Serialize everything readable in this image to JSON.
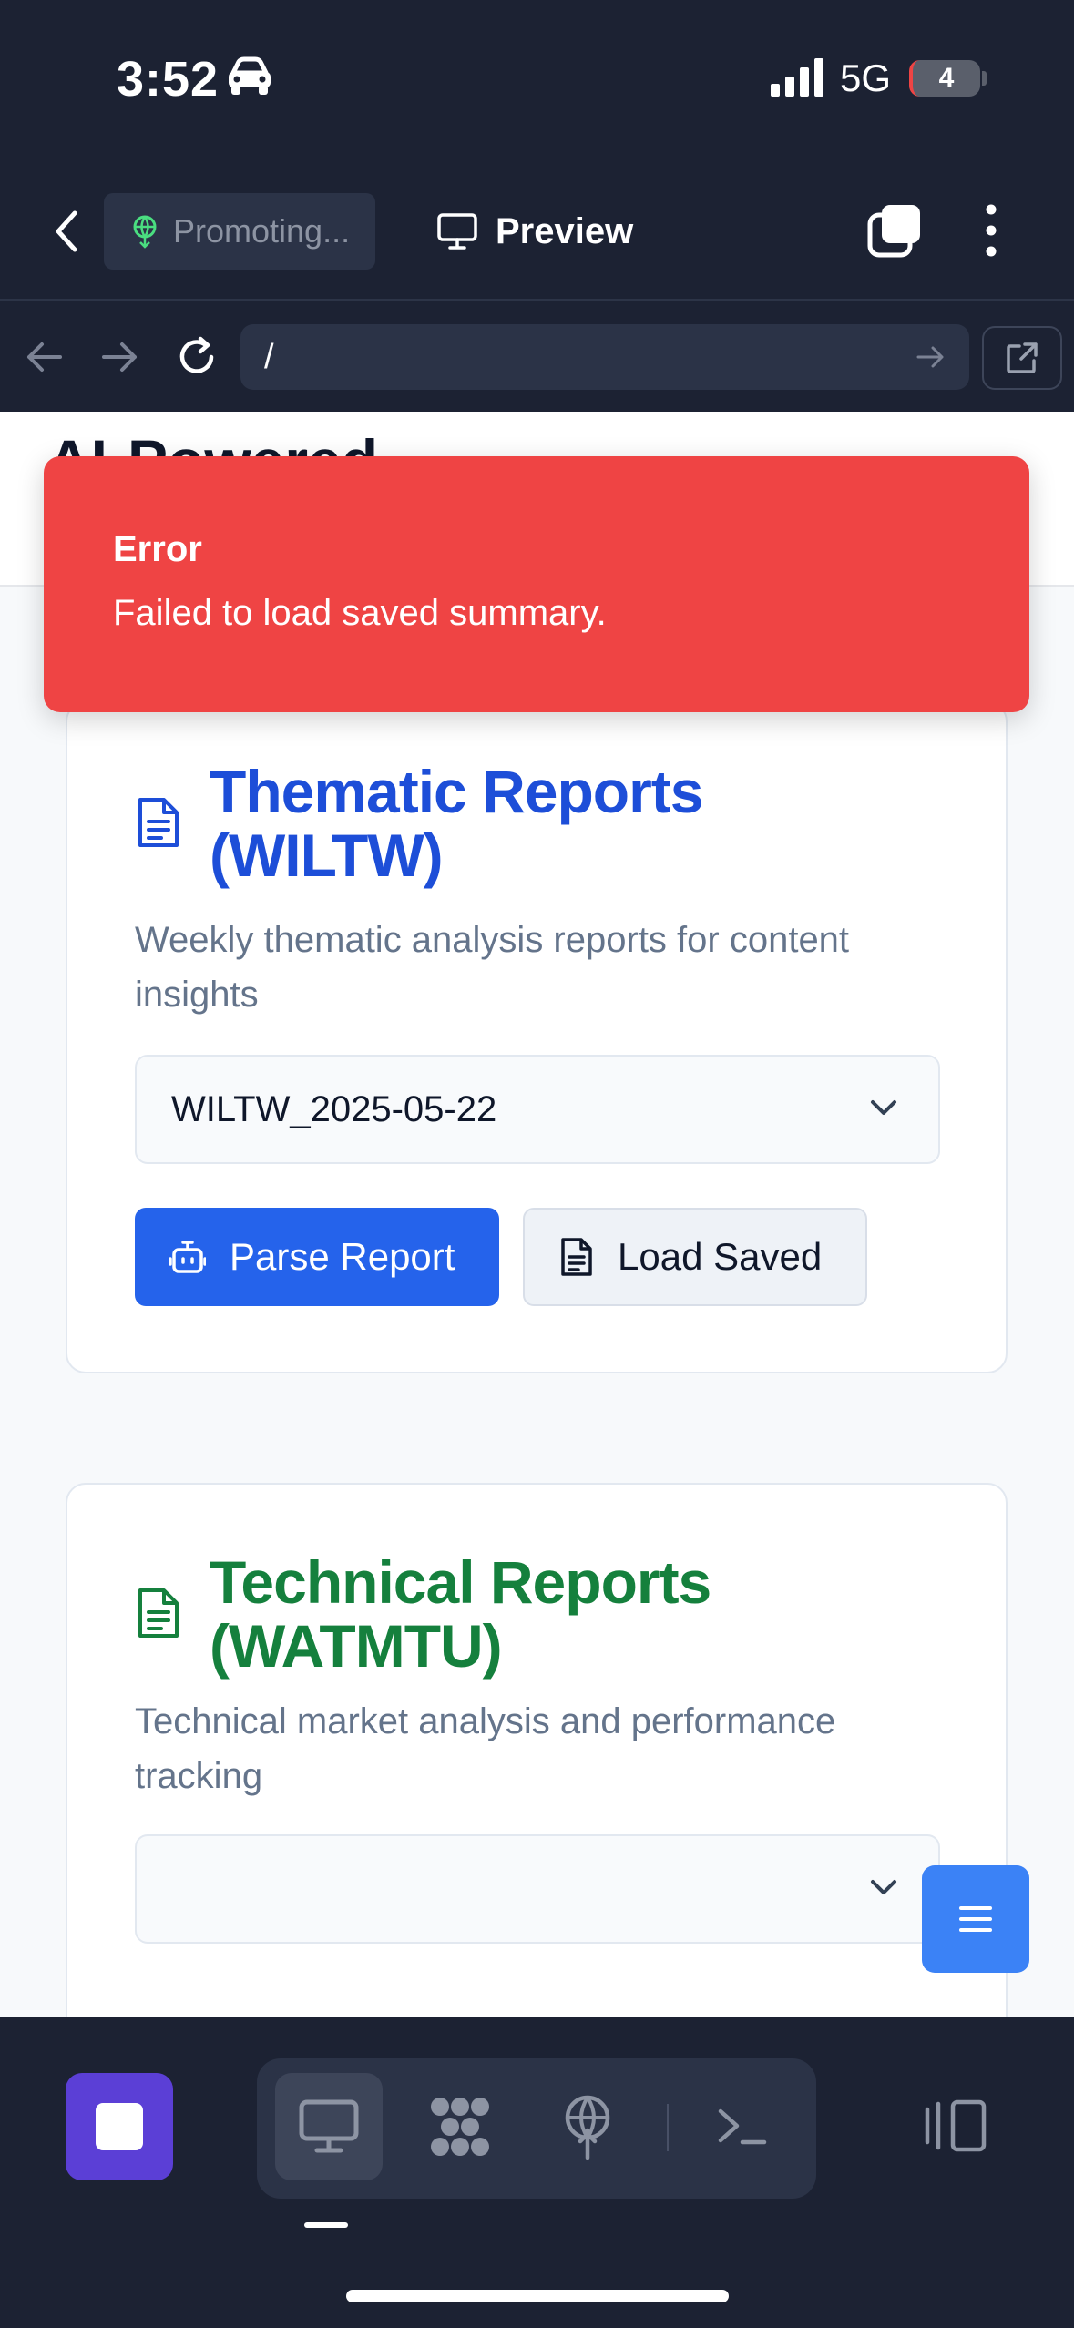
{
  "status_bar": {
    "time": "3:52",
    "network": "5G",
    "battery": "4"
  },
  "toolbar": {
    "project_label": "Promoting...",
    "preview_label": "Preview"
  },
  "url_bar": {
    "path": "/"
  },
  "page": {
    "heading": "AI-Powered"
  },
  "toast": {
    "title": "Error",
    "message": "Failed to load saved summary."
  },
  "cards": [
    {
      "title_line1": "Thematic Reports",
      "title_line2": "(WILTW)",
      "description": "Weekly thematic analysis reports for content insights",
      "selected_report": "WILTW_2025-05-22",
      "parse_label": "Parse Report",
      "load_label": "Load Saved",
      "accent": "#1d4ed8"
    },
    {
      "title_line1": "Technical Reports",
      "title_line2": "(WATMTU)",
      "description": "Technical market analysis and performance tracking",
      "selected_report": "",
      "accent": "#15803d"
    }
  ],
  "colors": {
    "chrome_bg": "#1c2233",
    "primary_button": "#2563eb",
    "error_toast": "#ef4444",
    "stop_button": "#5b3fd6"
  },
  "icons": [
    "car-icon",
    "signal-icon",
    "globe-icon",
    "monitor-icon",
    "tabs-icon",
    "more-icon",
    "back-arrow-icon",
    "forward-arrow-icon",
    "reload-icon",
    "external-link-icon",
    "document-icon",
    "robot-icon",
    "chevron-down-icon",
    "menu-icon",
    "stop-icon",
    "apps-icon",
    "deploy-icon",
    "terminal-icon",
    "panel-icon"
  ]
}
